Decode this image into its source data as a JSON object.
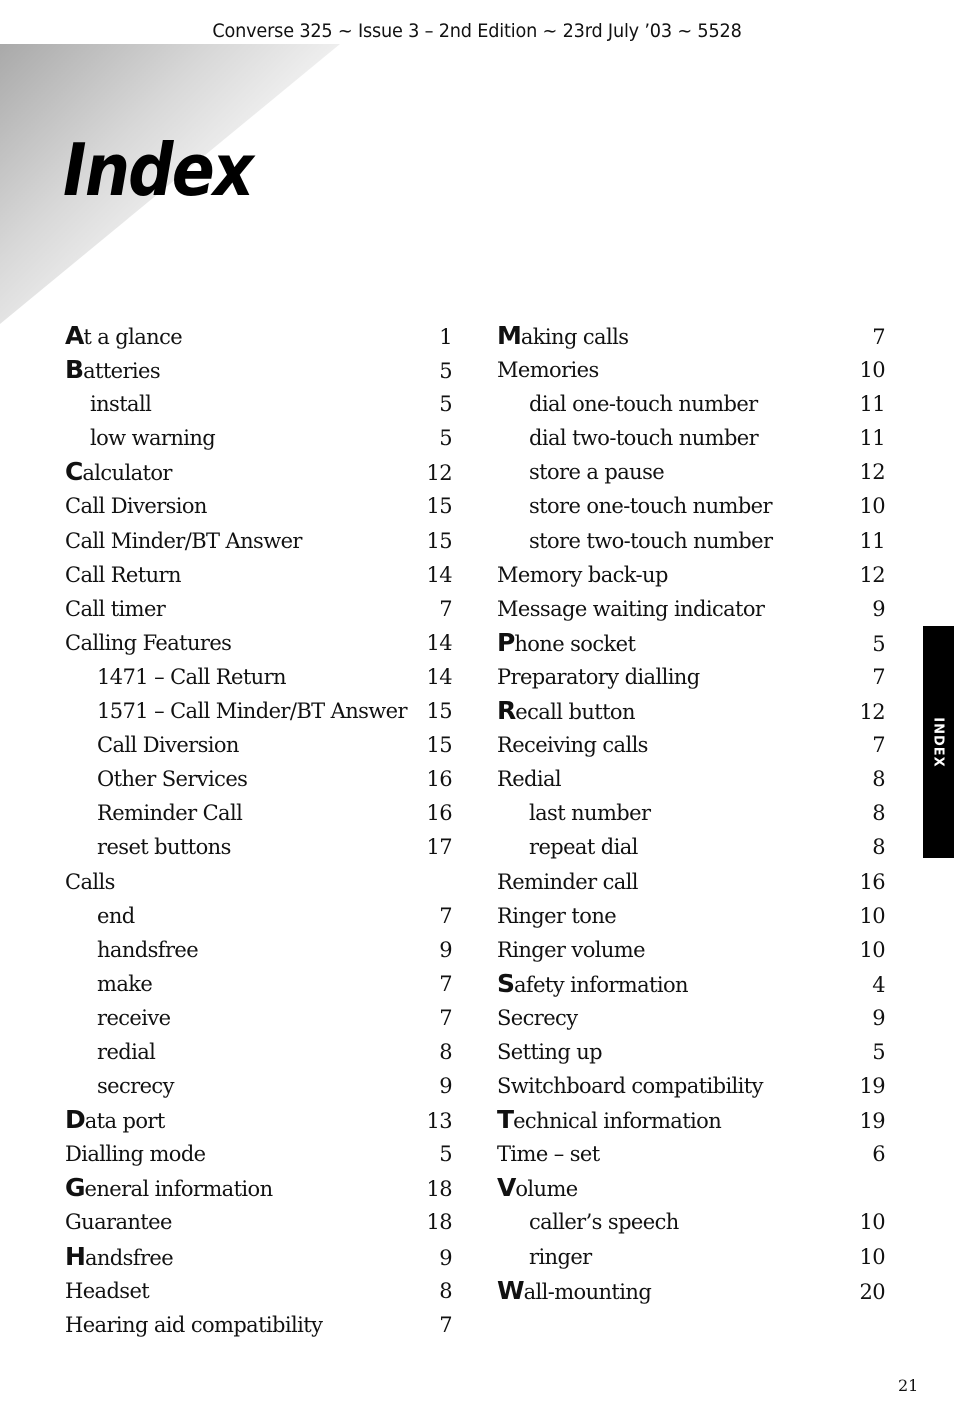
{
  "header": {
    "running_head": "Converse 325 ~ Issue 3 – 2nd Edition ~ 23rd July ’03 ~ 5528"
  },
  "title": "Index",
  "side_tab": {
    "label": "INDEX"
  },
  "page_number": "21",
  "columns": [
    {
      "entries": [
        {
          "initial": "A",
          "rest": "t a glance",
          "page": "1",
          "level": 0
        },
        {
          "initial": "B",
          "rest": "atteries",
          "page": "5",
          "level": 0
        },
        {
          "initial": "",
          "rest": "install",
          "page": "5",
          "level": 1,
          "indent": "a"
        },
        {
          "initial": "",
          "rest": "low warning",
          "page": "5",
          "level": 1,
          "indent": "a"
        },
        {
          "initial": "C",
          "rest": "alculator",
          "page": "12",
          "level": 0
        },
        {
          "initial": "",
          "rest": "Call Diversion",
          "page": "15",
          "level": 0
        },
        {
          "initial": "",
          "rest": "Call Minder/BT Answer",
          "page": "15",
          "level": 0
        },
        {
          "initial": "",
          "rest": "Call Return",
          "page": "14",
          "level": 0
        },
        {
          "initial": "",
          "rest": "Call timer",
          "page": "7",
          "level": 0
        },
        {
          "initial": "",
          "rest": "Calling Features",
          "page": "14",
          "level": 0
        },
        {
          "initial": "",
          "rest": "1471 – Call Return",
          "page": "14",
          "level": 1
        },
        {
          "initial": "",
          "rest": "1571 – Call Minder/BT Answer",
          "page": "15",
          "level": 1
        },
        {
          "initial": "",
          "rest": "Call Diversion",
          "page": "15",
          "level": 1
        },
        {
          "initial": "",
          "rest": "Other Services",
          "page": "16",
          "level": 1
        },
        {
          "initial": "",
          "rest": "Reminder Call",
          "page": "16",
          "level": 1
        },
        {
          "initial": "",
          "rest": "reset buttons",
          "page": "17",
          "level": 1
        },
        {
          "initial": "",
          "rest": "Calls",
          "page": "",
          "level": 0
        },
        {
          "initial": "",
          "rest": "end",
          "page": "7",
          "level": 1
        },
        {
          "initial": "",
          "rest": "handsfree",
          "page": "9",
          "level": 1
        },
        {
          "initial": "",
          "rest": "make",
          "page": "7",
          "level": 1
        },
        {
          "initial": "",
          "rest": "receive",
          "page": "7",
          "level": 1
        },
        {
          "initial": "",
          "rest": "redial",
          "page": "8",
          "level": 1
        },
        {
          "initial": "",
          "rest": "secrecy",
          "page": "9",
          "level": 1
        },
        {
          "initial": "D",
          "rest": "ata port",
          "page": "13",
          "level": 0
        },
        {
          "initial": "",
          "rest": "Dialling mode",
          "page": "5",
          "level": 0
        },
        {
          "initial": "G",
          "rest": "eneral information",
          "page": "18",
          "level": 0
        },
        {
          "initial": "",
          "rest": "Guarantee",
          "page": "18",
          "level": 0
        },
        {
          "initial": "H",
          "rest": "andsfree",
          "page": "9",
          "level": 0
        },
        {
          "initial": "",
          "rest": "Headset",
          "page": "8",
          "level": 0
        },
        {
          "initial": "",
          "rest": "Hearing aid compatibility",
          "page": "7",
          "level": 0
        }
      ]
    },
    {
      "entries": [
        {
          "initial": "M",
          "rest": "aking calls",
          "page": "7",
          "level": 0
        },
        {
          "initial": "",
          "rest": "Memories",
          "page": "10",
          "level": 0
        },
        {
          "initial": "",
          "rest": "dial one-touch number",
          "page": "11",
          "level": 1
        },
        {
          "initial": "",
          "rest": "dial two-touch number",
          "page": "11",
          "level": 1
        },
        {
          "initial": "",
          "rest": "store a pause",
          "page": "12",
          "level": 1
        },
        {
          "initial": "",
          "rest": "store one-touch number",
          "page": "10",
          "level": 1
        },
        {
          "initial": "",
          "rest": "store two-touch number",
          "page": "11",
          "level": 1
        },
        {
          "initial": "",
          "rest": "Memory back-up",
          "page": "12",
          "level": 0
        },
        {
          "initial": "",
          "rest": "Message waiting indicator",
          "page": "9",
          "level": 0
        },
        {
          "initial": "P",
          "rest": "hone socket",
          "page": "5",
          "level": 0
        },
        {
          "initial": "",
          "rest": "Preparatory dialling",
          "page": "7",
          "level": 0
        },
        {
          "initial": "R",
          "rest": "ecall button",
          "page": "12",
          "level": 0
        },
        {
          "initial": "",
          "rest": "Receiving calls",
          "page": "7",
          "level": 0
        },
        {
          "initial": "",
          "rest": "Redial",
          "page": "8",
          "level": 0
        },
        {
          "initial": "",
          "rest": "last number",
          "page": "8",
          "level": 1
        },
        {
          "initial": "",
          "rest": "repeat dial",
          "page": "8",
          "level": 1
        },
        {
          "initial": "",
          "rest": "Reminder call",
          "page": "16",
          "level": 0
        },
        {
          "initial": "",
          "rest": "Ringer tone",
          "page": "10",
          "level": 0
        },
        {
          "initial": "",
          "rest": "Ringer volume",
          "page": "10",
          "level": 0
        },
        {
          "initial": "S",
          "rest": "afety information",
          "page": "4",
          "level": 0
        },
        {
          "initial": "",
          "rest": "Secrecy",
          "page": "9",
          "level": 0
        },
        {
          "initial": "",
          "rest": "Setting up",
          "page": "5",
          "level": 0
        },
        {
          "initial": "",
          "rest": "Switchboard compatibility",
          "page": "19",
          "level": 0
        },
        {
          "initial": "T",
          "rest": "echnical information",
          "page": "19",
          "level": 0
        },
        {
          "initial": "",
          "rest": "Time – set",
          "page": "6",
          "level": 0
        },
        {
          "initial": "V",
          "rest": "olume",
          "page": "",
          "level": 0
        },
        {
          "initial": "",
          "rest": "caller’s speech",
          "page": "10",
          "level": 1
        },
        {
          "initial": "",
          "rest": "ringer",
          "page": "10",
          "level": 1
        },
        {
          "initial": "W",
          "rest": "all-mounting",
          "page": "20",
          "level": 0
        }
      ]
    }
  ]
}
